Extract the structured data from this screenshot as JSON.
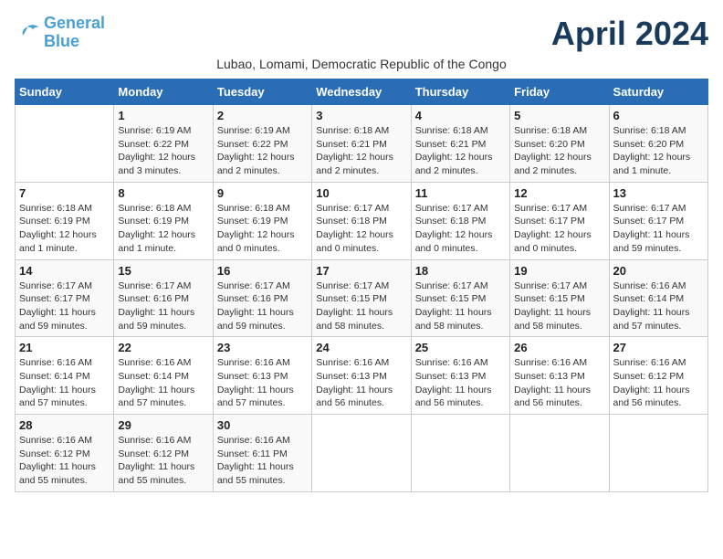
{
  "logo": {
    "line1": "General",
    "line2": "Blue"
  },
  "title": "April 2024",
  "subtitle": "Lubao, Lomami, Democratic Republic of the Congo",
  "weekdays": [
    "Sunday",
    "Monday",
    "Tuesday",
    "Wednesday",
    "Thursday",
    "Friday",
    "Saturday"
  ],
  "weeks": [
    [
      {
        "day": "",
        "info": ""
      },
      {
        "day": "1",
        "info": "Sunrise: 6:19 AM\nSunset: 6:22 PM\nDaylight: 12 hours\nand 3 minutes."
      },
      {
        "day": "2",
        "info": "Sunrise: 6:19 AM\nSunset: 6:22 PM\nDaylight: 12 hours\nand 2 minutes."
      },
      {
        "day": "3",
        "info": "Sunrise: 6:18 AM\nSunset: 6:21 PM\nDaylight: 12 hours\nand 2 minutes."
      },
      {
        "day": "4",
        "info": "Sunrise: 6:18 AM\nSunset: 6:21 PM\nDaylight: 12 hours\nand 2 minutes."
      },
      {
        "day": "5",
        "info": "Sunrise: 6:18 AM\nSunset: 6:20 PM\nDaylight: 12 hours\nand 2 minutes."
      },
      {
        "day": "6",
        "info": "Sunrise: 6:18 AM\nSunset: 6:20 PM\nDaylight: 12 hours\nand 1 minute."
      }
    ],
    [
      {
        "day": "7",
        "info": "Sunrise: 6:18 AM\nSunset: 6:19 PM\nDaylight: 12 hours\nand 1 minute."
      },
      {
        "day": "8",
        "info": "Sunrise: 6:18 AM\nSunset: 6:19 PM\nDaylight: 12 hours\nand 1 minute."
      },
      {
        "day": "9",
        "info": "Sunrise: 6:18 AM\nSunset: 6:19 PM\nDaylight: 12 hours\nand 0 minutes."
      },
      {
        "day": "10",
        "info": "Sunrise: 6:17 AM\nSunset: 6:18 PM\nDaylight: 12 hours\nand 0 minutes."
      },
      {
        "day": "11",
        "info": "Sunrise: 6:17 AM\nSunset: 6:18 PM\nDaylight: 12 hours\nand 0 minutes."
      },
      {
        "day": "12",
        "info": "Sunrise: 6:17 AM\nSunset: 6:17 PM\nDaylight: 12 hours\nand 0 minutes."
      },
      {
        "day": "13",
        "info": "Sunrise: 6:17 AM\nSunset: 6:17 PM\nDaylight: 11 hours\nand 59 minutes."
      }
    ],
    [
      {
        "day": "14",
        "info": "Sunrise: 6:17 AM\nSunset: 6:17 PM\nDaylight: 11 hours\nand 59 minutes."
      },
      {
        "day": "15",
        "info": "Sunrise: 6:17 AM\nSunset: 6:16 PM\nDaylight: 11 hours\nand 59 minutes."
      },
      {
        "day": "16",
        "info": "Sunrise: 6:17 AM\nSunset: 6:16 PM\nDaylight: 11 hours\nand 59 minutes."
      },
      {
        "day": "17",
        "info": "Sunrise: 6:17 AM\nSunset: 6:15 PM\nDaylight: 11 hours\nand 58 minutes."
      },
      {
        "day": "18",
        "info": "Sunrise: 6:17 AM\nSunset: 6:15 PM\nDaylight: 11 hours\nand 58 minutes."
      },
      {
        "day": "19",
        "info": "Sunrise: 6:17 AM\nSunset: 6:15 PM\nDaylight: 11 hours\nand 58 minutes."
      },
      {
        "day": "20",
        "info": "Sunrise: 6:16 AM\nSunset: 6:14 PM\nDaylight: 11 hours\nand 57 minutes."
      }
    ],
    [
      {
        "day": "21",
        "info": "Sunrise: 6:16 AM\nSunset: 6:14 PM\nDaylight: 11 hours\nand 57 minutes."
      },
      {
        "day": "22",
        "info": "Sunrise: 6:16 AM\nSunset: 6:14 PM\nDaylight: 11 hours\nand 57 minutes."
      },
      {
        "day": "23",
        "info": "Sunrise: 6:16 AM\nSunset: 6:13 PM\nDaylight: 11 hours\nand 57 minutes."
      },
      {
        "day": "24",
        "info": "Sunrise: 6:16 AM\nSunset: 6:13 PM\nDaylight: 11 hours\nand 56 minutes."
      },
      {
        "day": "25",
        "info": "Sunrise: 6:16 AM\nSunset: 6:13 PM\nDaylight: 11 hours\nand 56 minutes."
      },
      {
        "day": "26",
        "info": "Sunrise: 6:16 AM\nSunset: 6:13 PM\nDaylight: 11 hours\nand 56 minutes."
      },
      {
        "day": "27",
        "info": "Sunrise: 6:16 AM\nSunset: 6:12 PM\nDaylight: 11 hours\nand 56 minutes."
      }
    ],
    [
      {
        "day": "28",
        "info": "Sunrise: 6:16 AM\nSunset: 6:12 PM\nDaylight: 11 hours\nand 55 minutes."
      },
      {
        "day": "29",
        "info": "Sunrise: 6:16 AM\nSunset: 6:12 PM\nDaylight: 11 hours\nand 55 minutes."
      },
      {
        "day": "30",
        "info": "Sunrise: 6:16 AM\nSunset: 6:11 PM\nDaylight: 11 hours\nand 55 minutes."
      },
      {
        "day": "",
        "info": ""
      },
      {
        "day": "",
        "info": ""
      },
      {
        "day": "",
        "info": ""
      },
      {
        "day": "",
        "info": ""
      }
    ]
  ]
}
